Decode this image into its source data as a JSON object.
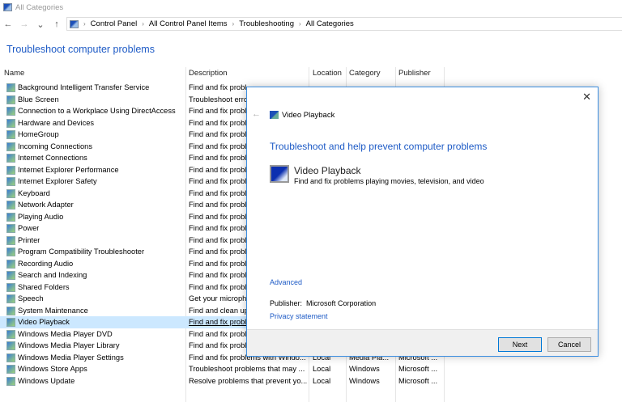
{
  "window": {
    "title": "All Categories"
  },
  "nav": {
    "back": "←",
    "forward": "→",
    "recent": "⌄",
    "up": "↑"
  },
  "breadcrumb": [
    "Control Panel",
    "All Control Panel Items",
    "Troubleshooting",
    "All Categories"
  ],
  "page_title": "Troubleshoot computer problems",
  "columns": [
    "Name",
    "Description",
    "Location",
    "Category",
    "Publisher"
  ],
  "rows": [
    {
      "name": "Background Intelligent Transfer Service",
      "desc": "Find and fix probl"
    },
    {
      "name": "Blue Screen",
      "desc": "Troubleshoot erro"
    },
    {
      "name": "Connection to a Workplace Using DirectAccess",
      "desc": "Find and fix probl"
    },
    {
      "name": "Hardware and Devices",
      "desc": "Find and fix probl"
    },
    {
      "name": "HomeGroup",
      "desc": "Find and fix probl"
    },
    {
      "name": "Incoming Connections",
      "desc": "Find and fix probl"
    },
    {
      "name": "Internet Connections",
      "desc": "Find and fix probl"
    },
    {
      "name": "Internet Explorer Performance",
      "desc": "Find and fix probl"
    },
    {
      "name": "Internet Explorer Safety",
      "desc": "Find and fix probl"
    },
    {
      "name": "Keyboard",
      "desc": "Find and fix probl"
    },
    {
      "name": "Network Adapter",
      "desc": "Find and fix probl"
    },
    {
      "name": "Playing Audio",
      "desc": "Find and fix probl"
    },
    {
      "name": "Power",
      "desc": "Find and fix probl"
    },
    {
      "name": "Printer",
      "desc": "Find and fix probl"
    },
    {
      "name": "Program Compatibility Troubleshooter",
      "desc": "Find and fix probl"
    },
    {
      "name": "Recording Audio",
      "desc": "Find and fix probl"
    },
    {
      "name": "Search and Indexing",
      "desc": "Find and fix probl"
    },
    {
      "name": "Shared Folders",
      "desc": "Find and fix probl"
    },
    {
      "name": "Speech",
      "desc": "Get your microph"
    },
    {
      "name": "System Maintenance",
      "desc": "Find and clean up"
    },
    {
      "name": "Video Playback",
      "desc": "Find and fix probl",
      "selected": true
    },
    {
      "name": "Windows Media Player DVD",
      "desc": "Find and fix probl"
    },
    {
      "name": "Windows Media Player Library",
      "desc": "Find and fix probl"
    },
    {
      "name": "Windows Media Player Settings",
      "desc": "Find and fix problems with Windo...",
      "loc": "Local",
      "cat": "Media Pla...",
      "pub": "Microsoft ..."
    },
    {
      "name": "Windows Store Apps",
      "desc": "Troubleshoot problems that may ...",
      "loc": "Local",
      "cat": "Windows",
      "pub": "Microsoft ..."
    },
    {
      "name": "Windows Update",
      "desc": "Resolve problems that prevent yo...",
      "loc": "Local",
      "cat": "Windows",
      "pub": "Microsoft ..."
    }
  ],
  "dialog": {
    "close": "✕",
    "back": "←",
    "title": "Video Playback",
    "heading": "Troubleshoot and help prevent computer problems",
    "item_title": "Video Playback",
    "item_desc": "Find and fix problems playing movies, television, and video",
    "advanced": "Advanced",
    "publisher_label": "Publisher:",
    "publisher": "Microsoft Corporation",
    "privacy": "Privacy statement",
    "next": "Next",
    "cancel": "Cancel"
  },
  "colors": {
    "accent": "#1e5bc6",
    "selection": "#cce8ff",
    "dialog_border": "#3c8ee0"
  }
}
